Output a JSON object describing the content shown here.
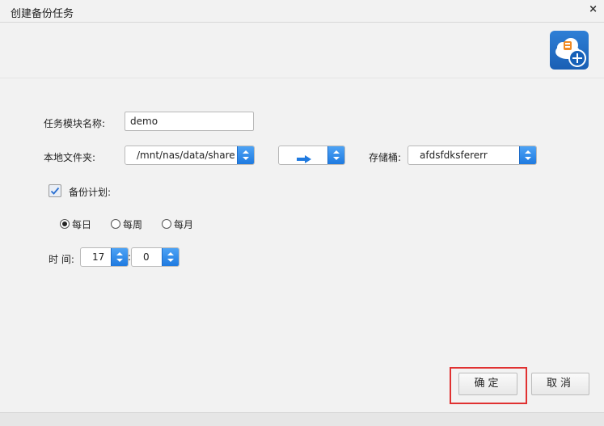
{
  "dialog": {
    "title": "创建备份任务",
    "close_glyph": "×"
  },
  "form": {
    "task_name_label": "任务模块名称:",
    "task_name_value": "demo",
    "local_folder_label": "本地文件夹:",
    "local_folder_value": "/mnt/nas/data/share",
    "direction_icon": "arrow-right-icon",
    "bucket_label": "存储桶:",
    "bucket_value": "afdsfdksfererr",
    "schedule_label": "备份计划:",
    "schedule_checked": true,
    "frequency_options": [
      "每日",
      "每周",
      "每月"
    ],
    "frequency_selected": "每日",
    "time_label": "时 间:",
    "hour_value": "17",
    "time_separator": ":",
    "minute_value": "0"
  },
  "buttons": {
    "confirm": "确定",
    "cancel": "取消"
  },
  "colors": {
    "accent": "#1f7ae0",
    "highlight": "#e03131"
  }
}
